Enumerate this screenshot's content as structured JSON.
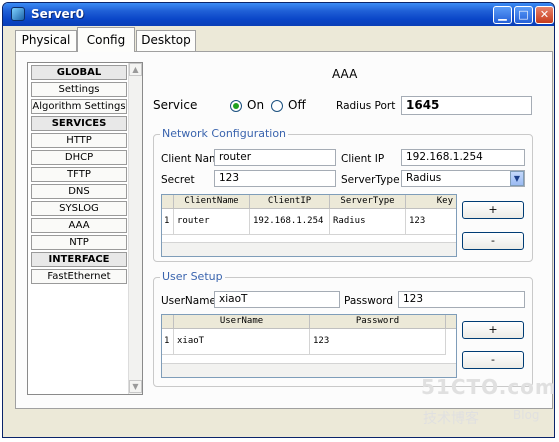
{
  "window": {
    "title": "Server0"
  },
  "tabs": [
    {
      "label": "Physical",
      "active": false
    },
    {
      "label": "Config",
      "active": true
    },
    {
      "label": "Desktop",
      "active": false
    }
  ],
  "nav": {
    "items": [
      {
        "label": "GLOBAL",
        "header": true
      },
      {
        "label": "Settings"
      },
      {
        "label": "Algorithm Settings"
      },
      {
        "label": "SERVICES",
        "header": true
      },
      {
        "label": "HTTP"
      },
      {
        "label": "DHCP"
      },
      {
        "label": "TFTP"
      },
      {
        "label": "DNS"
      },
      {
        "label": "SYSLOG"
      },
      {
        "label": "AAA"
      },
      {
        "label": "NTP"
      },
      {
        "label": "INTERFACE",
        "header": true
      },
      {
        "label": "FastEthernet"
      }
    ]
  },
  "main": {
    "title": "AAA",
    "service_label": "Service",
    "on_label": "On",
    "off_label": "Off",
    "service_state": "On",
    "radius_port_label": "Radius Port",
    "radius_port_value": "1645"
  },
  "network_config": {
    "legend": "Network Configuration",
    "client_name_label": "Client Name",
    "client_name_value": "router",
    "client_ip_label": "Client IP",
    "client_ip_value": "192.168.1.254",
    "secret_label": "Secret",
    "secret_value": "123",
    "server_type_label": "ServerType",
    "server_type_value": "Radius",
    "table": {
      "columns": [
        "ClientName",
        "ClientIP",
        "ServerType",
        "Key"
      ],
      "rows": [
        {
          "index": "1",
          "cells": [
            "router",
            "192.168.1.254",
            "Radius",
            "123"
          ]
        }
      ]
    },
    "add_label": "+",
    "remove_label": "-"
  },
  "user_setup": {
    "legend": "User Setup",
    "username_label": "UserName",
    "username_value": "xiaoT",
    "password_label": "Password",
    "password_value": "123",
    "table": {
      "columns": [
        "UserName",
        "Password"
      ],
      "rows": [
        {
          "index": "1",
          "cells": [
            "xiaoT",
            "123"
          ]
        }
      ]
    },
    "add_label": "+",
    "remove_label": "-"
  },
  "watermark": {
    "line1": "51CTO.com",
    "line2": "技术博客",
    "line3": "Blog"
  },
  "colors": {
    "title_bar": "#0a46c8",
    "legend_text": "#3a64ae",
    "radio_on": "#21a121"
  }
}
